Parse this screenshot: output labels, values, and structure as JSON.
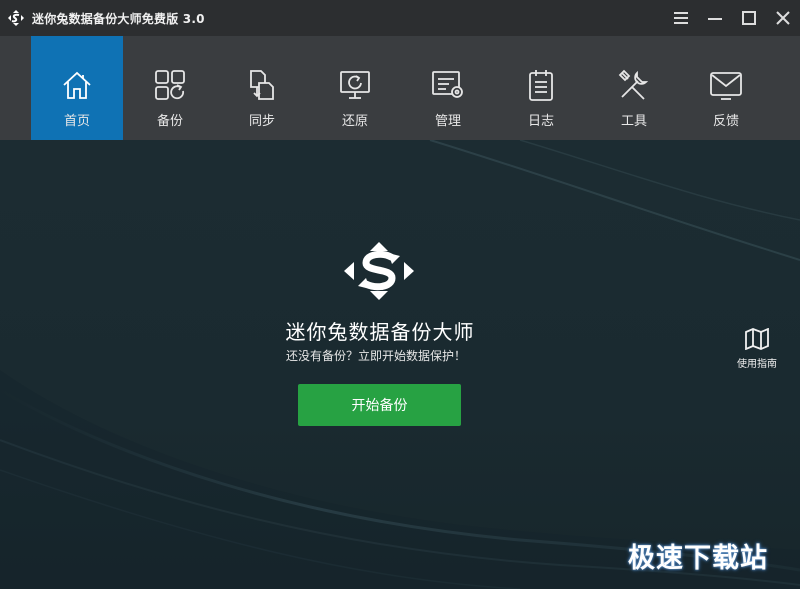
{
  "titlebar": {
    "title": "迷你兔数据备份大师免费版 3.0"
  },
  "nav": {
    "items": [
      {
        "label": "首页",
        "icon": "home-icon",
        "active": true
      },
      {
        "label": "备份",
        "icon": "backup-icon"
      },
      {
        "label": "同步",
        "icon": "sync-icon"
      },
      {
        "label": "还原",
        "icon": "restore-icon"
      },
      {
        "label": "管理",
        "icon": "manage-icon"
      },
      {
        "label": "日志",
        "icon": "log-icon"
      },
      {
        "label": "工具",
        "icon": "tools-icon"
      },
      {
        "label": "反馈",
        "icon": "feedback-icon"
      }
    ]
  },
  "main": {
    "product_name": "迷你兔数据备份大师",
    "subtitle": "还没有备份？立即开始数据保护！",
    "start_button": "开始备份",
    "guide_label": "使用指南",
    "watermark": "极速下载站"
  },
  "colors": {
    "titlebar_bg": "#2c2e30",
    "nav_bg": "#3a3d40",
    "nav_active_bg": "#0f72b4",
    "main_bg": "#1b2b31",
    "primary_button": "#27a243"
  }
}
